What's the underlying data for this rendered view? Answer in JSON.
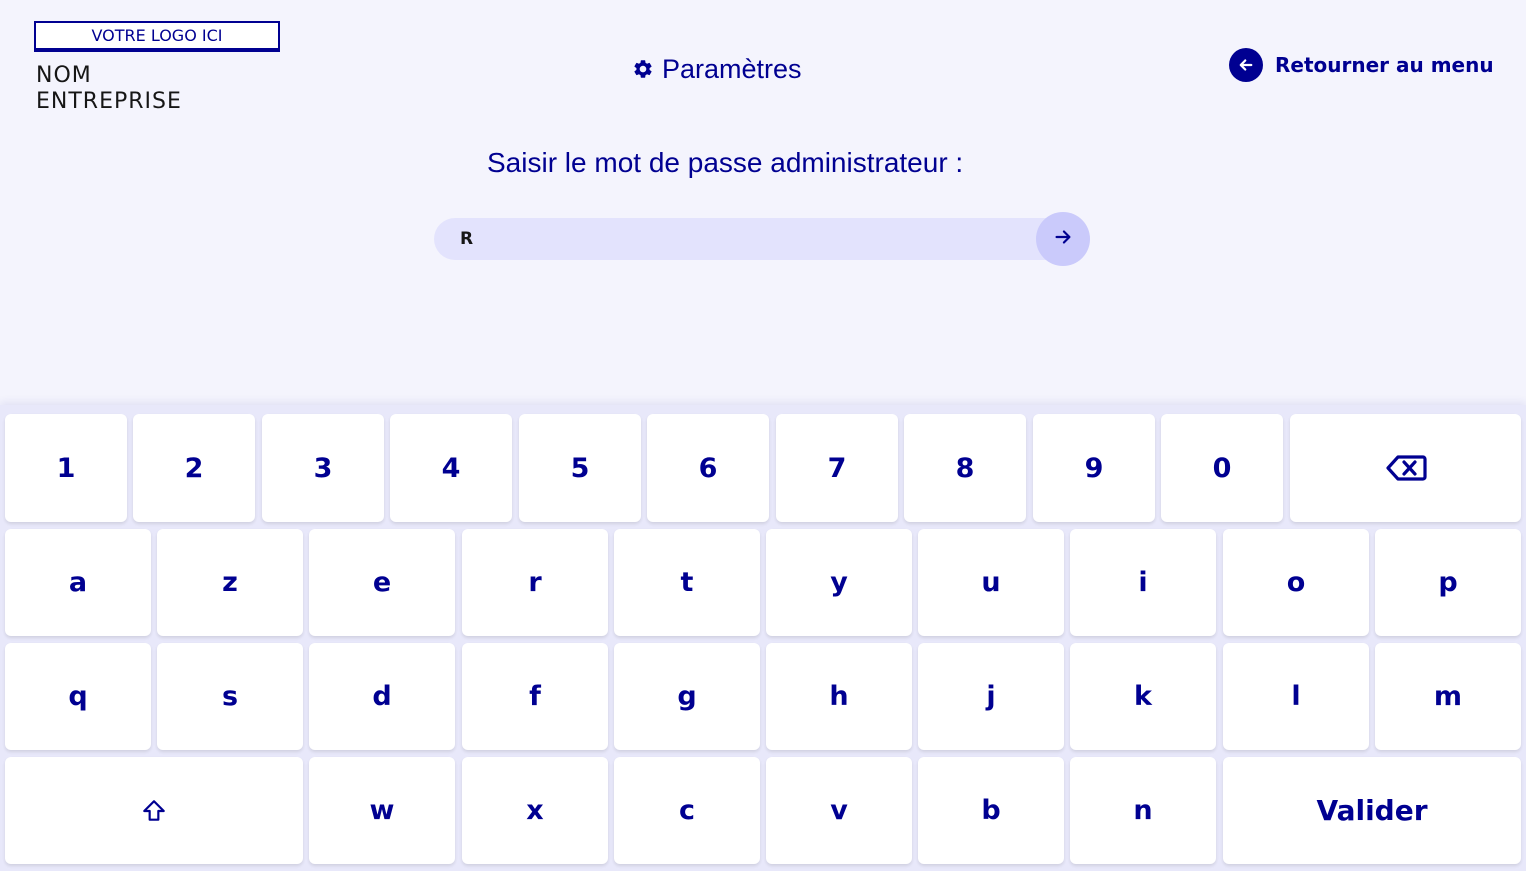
{
  "header": {
    "logo_placeholder": "VOTRE LOGO ICI",
    "company_line1": "NOM",
    "company_line2": "ENTREPRISE",
    "title": "Paramètres",
    "title_icon": "gear-icon",
    "back_label": "Retourner au menu",
    "back_icon": "arrow-left-icon"
  },
  "password": {
    "prompt": "Saisir le mot de passe administrateur :",
    "value": "R",
    "submit_icon": "arrow-right-icon"
  },
  "keyboard": {
    "row1": [
      "1",
      "2",
      "3",
      "4",
      "5",
      "6",
      "7",
      "8",
      "9",
      "0"
    ],
    "backspace_icon": "backspace-icon",
    "row2": [
      "a",
      "z",
      "e",
      "r",
      "t",
      "y",
      "u",
      "i",
      "o",
      "p"
    ],
    "row3": [
      "q",
      "s",
      "d",
      "f",
      "g",
      "h",
      "j",
      "k",
      "l",
      "m"
    ],
    "shift_icon": "shift-icon",
    "row4": [
      "w",
      "x",
      "c",
      "v",
      "b",
      "n"
    ],
    "submit_label": "Valider"
  },
  "colors": {
    "primary": "#000091",
    "background": "#f4f4fd",
    "input_background": "#e3e3fd",
    "submit_circle": "#cacafb",
    "key_background": "#ffffff"
  }
}
